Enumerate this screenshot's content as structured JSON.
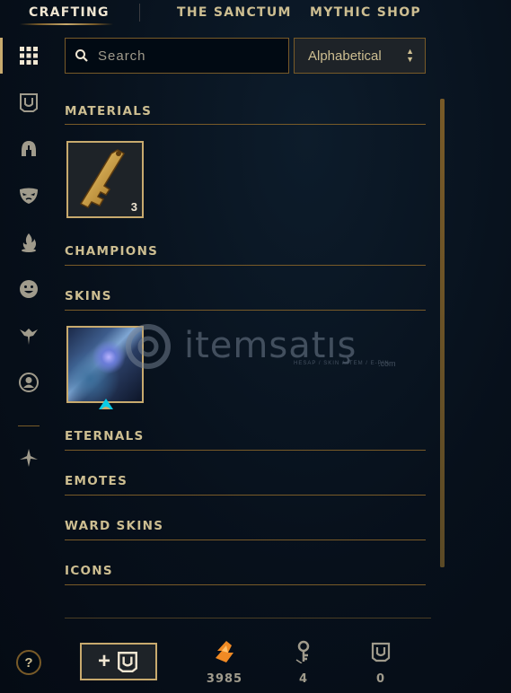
{
  "nav": {
    "tabs": [
      {
        "label": "CRAFTING",
        "active": true
      },
      {
        "label": "THE SANCTUM",
        "active": false
      },
      {
        "label": "MYTHIC SHOP",
        "active": false
      }
    ]
  },
  "sidebar": {
    "items": [
      {
        "icon": "grid-icon",
        "active": true
      },
      {
        "icon": "chest-icon",
        "active": false
      },
      {
        "icon": "helmet-icon",
        "active": false
      },
      {
        "icon": "mask-icon",
        "active": false
      },
      {
        "icon": "flame-icon",
        "active": false
      },
      {
        "icon": "emote-face-icon",
        "active": false
      },
      {
        "icon": "ward-icon",
        "active": false
      },
      {
        "icon": "profile-icon",
        "active": false
      },
      {
        "icon": "eternals-icon",
        "active": false
      }
    ],
    "help_label": "?"
  },
  "toolbar": {
    "search_placeholder": "Search",
    "sort_value": "Alphabetical"
  },
  "sections": {
    "materials": "MATERIALS",
    "champions": "CHAMPIONS",
    "skins": "SKINS",
    "eternals": "ETERNALS",
    "emotes": "EMOTES",
    "ward_skins": "WARD SKINS",
    "icons": "ICONS"
  },
  "materials": {
    "items": [
      {
        "icon": "key-fragment-icon",
        "count": "3"
      }
    ]
  },
  "skins": {
    "items": [
      {
        "icon": "skin-shard-art"
      }
    ]
  },
  "watermark": {
    "text": "itemsatış",
    "sub": "HESAP / SKIN / ITEM / E-PIN",
    "domain": ".com"
  },
  "footer": {
    "add_button_label": "+",
    "currencies": [
      {
        "icon": "orange-essence-icon",
        "value": "3985"
      },
      {
        "icon": "key-icon",
        "value": "4"
      },
      {
        "icon": "chest-icon",
        "value": "0"
      }
    ]
  },
  "colors": {
    "gold": "#c8aa6e",
    "gold_dark": "#785a28",
    "text": "#cdbe91",
    "background": "#07101b",
    "orange_essence": "#f08a24"
  }
}
